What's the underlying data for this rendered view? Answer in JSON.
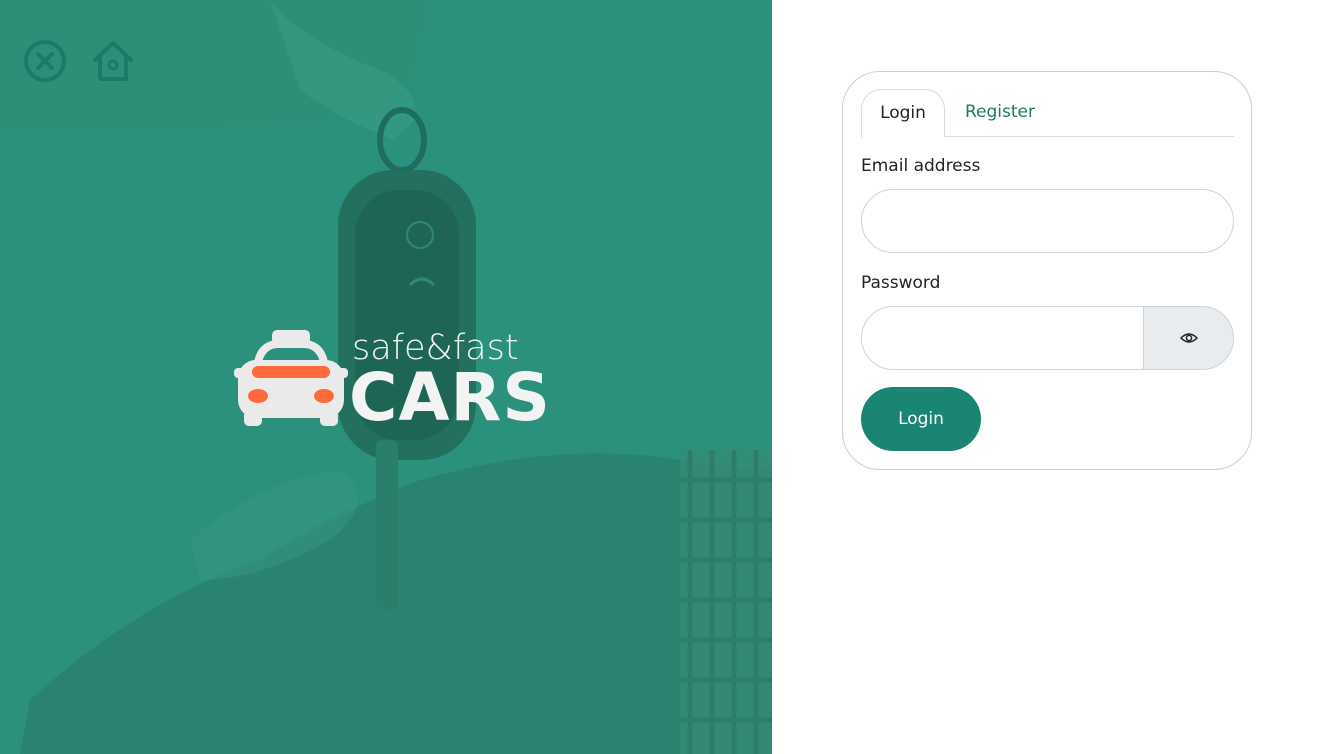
{
  "hero": {
    "logo_tagline": "safe&fast",
    "logo_brand": "CARS",
    "background_color": "#2b917d",
    "accent_color": "#ff6a3d"
  },
  "top_icons": [
    {
      "icon": "close-circle-icon"
    },
    {
      "icon": "home-icon"
    }
  ],
  "auth_card": {
    "tabs": [
      {
        "label": "Login",
        "active": true
      },
      {
        "label": "Register",
        "active": false
      }
    ],
    "email_label": "Email address",
    "email_value": "",
    "password_label": "Password",
    "password_value": "",
    "toggle_visibility_icon": "eye-icon",
    "submit_label": "Login",
    "primary_color": "#1a8572"
  }
}
